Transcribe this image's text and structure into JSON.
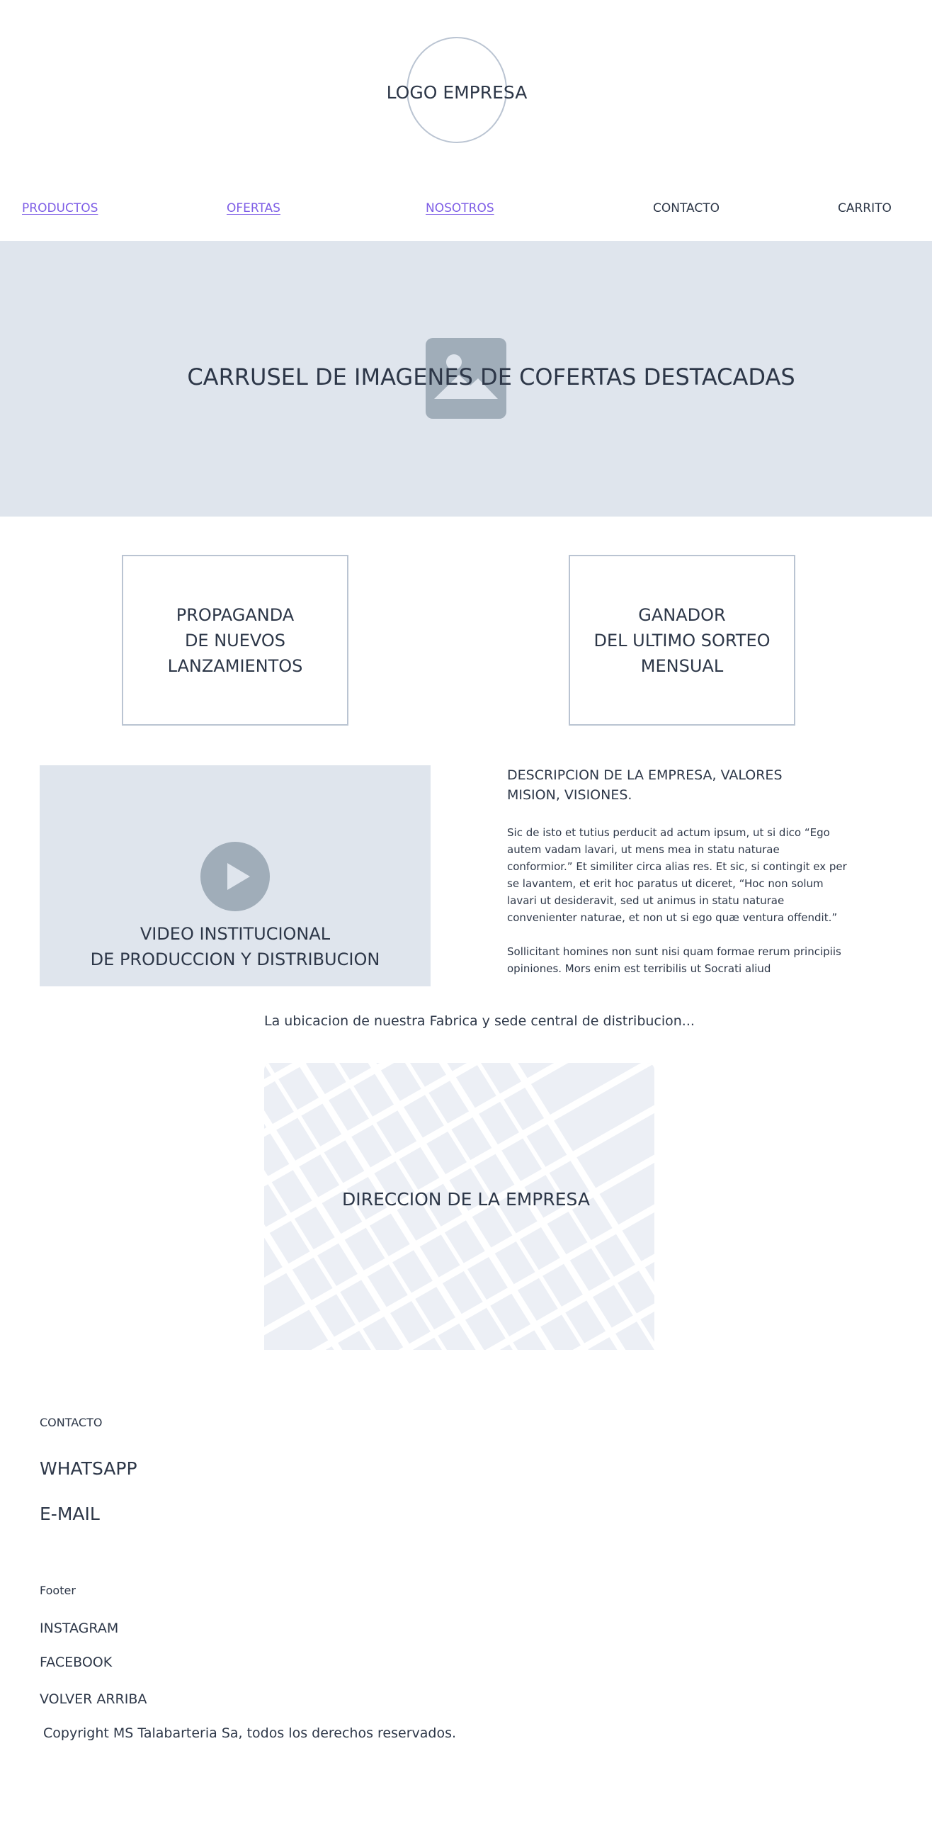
{
  "header": {
    "logo_text": "LOGO EMPRESA"
  },
  "nav": {
    "items": [
      {
        "label": "PRODUCTOS"
      },
      {
        "label": "OFERTAS"
      },
      {
        "label": "NOSOTROS"
      },
      {
        "label": "CONTACTO"
      },
      {
        "label": "CARRITO"
      }
    ]
  },
  "hero": {
    "text": "CARRUSEL DE IMAGENES DE COFERTAS DESTACADAS",
    "icon": "image-placeholder-icon"
  },
  "promos": {
    "left": {
      "lines": [
        "PROPAGANDA",
        "DE NUEVOS",
        "LANZAMIENTOS"
      ]
    },
    "right": {
      "lines": [
        "GANADOR",
        "DEL ULTIMO SORTEO",
        "MENSUAL"
      ]
    }
  },
  "video": {
    "icon": "play-icon",
    "title_lines": [
      "VIDEO INSTITUCIONAL",
      "DE PRODUCCION Y DISTRIBUCION"
    ]
  },
  "description": {
    "title_lines": [
      "DESCRIPCION DE LA EMPRESA, VALORES",
      "MISION, VISIONES."
    ],
    "paragraphs": [
      "Sic de isto et tutius perducit ad actum ipsum, ut si dico “Ego autem vadam lavari, ut mens mea in statu naturae conformior.” Et similiter circa alias res. Et sic, si contingit ex per se lavantem, et erit hoc paratus ut diceret, “Hoc non solum lavari ut desideravit, sed ut animus in statu naturae convenienter naturae, et non ut si ego quæ ventura offendit.”",
      "Sollicitant homines non sunt nisi quam formae rerum principiis opiniones. Mors enim est terribilis ut Socrati aliud"
    ]
  },
  "location": {
    "text": "La ubicacion de nuestra Fabrica y sede central de distribucion...",
    "map_label": "DIRECCION DE LA EMPRESA"
  },
  "contact": {
    "heading": "CONTACTO",
    "whatsapp": "WHATSAPP",
    "email": "E-MAIL"
  },
  "footer": {
    "heading": "Footer",
    "instagram": "INSTAGRAM",
    "facebook": "FACEBOOK",
    "back_to_top": "VOLVER ARRIBA",
    "copyright": "Copyright MS Talabarteria Sa, todos los derechos reservados."
  },
  "colors": {
    "link": "#7e5ee6",
    "text": "#2d3748",
    "placeholder_bg": "#dfe5ed",
    "placeholder_icon": "#a0adb9",
    "border": "#bac4d2"
  }
}
